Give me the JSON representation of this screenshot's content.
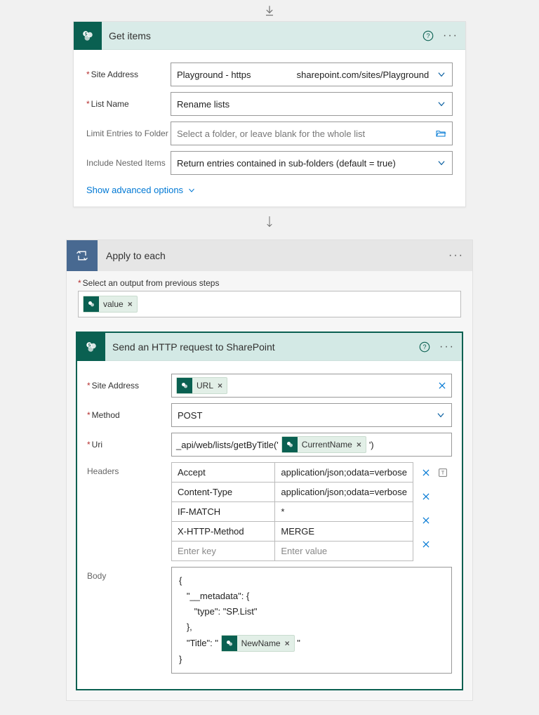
{
  "arrows": {},
  "getItems": {
    "title": "Get items",
    "fields": {
      "siteAddress": {
        "label": "Site Address",
        "value_prefix": "Playground - https",
        "value_suffix": "sharepoint.com/sites/Playground"
      },
      "listName": {
        "label": "List Name",
        "value": "Rename lists"
      },
      "limitEntries": {
        "label": "Limit Entries to Folder",
        "placeholder": "Select a folder, or leave blank for the whole list"
      },
      "includeNested": {
        "label": "Include Nested Items",
        "value": "Return entries contained in sub-folders (default = true)"
      }
    },
    "advanced": "Show advanced options"
  },
  "applyEach": {
    "title": "Apply to each",
    "selectLabel": "Select an output from previous steps",
    "token": "value"
  },
  "httpReq": {
    "title": "Send an HTTP request to SharePoint",
    "siteAddress": {
      "label": "Site Address",
      "token": "URL"
    },
    "method": {
      "label": "Method",
      "value": "POST"
    },
    "uri": {
      "label": "Uri",
      "prefix": "_api/web/lists/getByTitle('",
      "token": "CurrentName",
      "suffix": "')"
    },
    "headersLabel": "Headers",
    "headers": [
      {
        "k": "Accept",
        "v": "application/json;odata=verbose"
      },
      {
        "k": "Content-Type",
        "v": "application/json;odata=verbose"
      },
      {
        "k": "IF-MATCH",
        "v": "*"
      },
      {
        "k": "X-HTTP-Method",
        "v": "MERGE"
      }
    ],
    "headersPlaceholder": {
      "k": "Enter key",
      "v": "Enter value"
    },
    "bodyLabel": "Body",
    "body": {
      "line1": "{",
      "line2": "   \"__metadata\": {",
      "line3": "      \"type\": \"SP.List\"",
      "line4": "   },",
      "line5_pre": "   \"Title\": \" ",
      "line5_token": "NewName",
      "line5_post": " \"",
      "line6": "}"
    }
  }
}
